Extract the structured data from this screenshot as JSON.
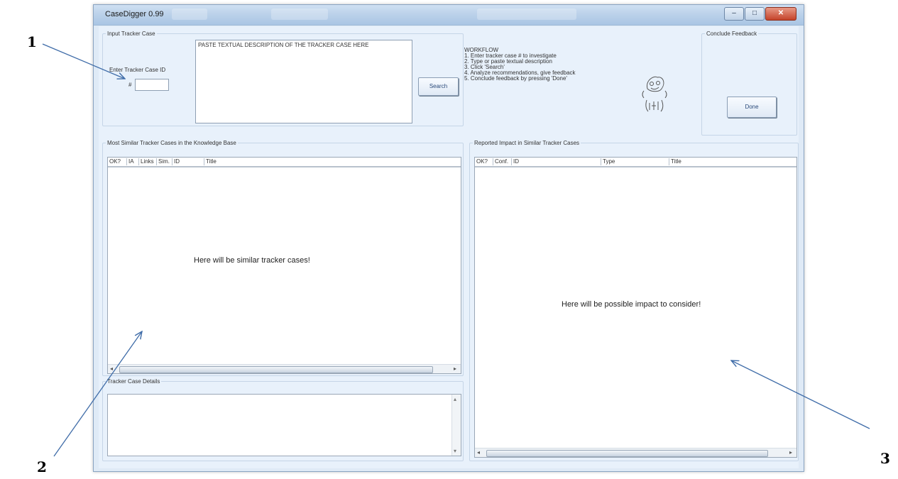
{
  "window": {
    "title": "CaseDigger 0.99",
    "buttons": {
      "minimize": "–",
      "maximize": "□",
      "close": "✕"
    }
  },
  "callouts": [
    "1",
    "2",
    "3"
  ],
  "input_group": {
    "legend": "Input Tracker Case",
    "case_id_label": "Enter Tracker Case ID",
    "hash_label": "#",
    "case_id_value": "",
    "description_placeholder": "PASTE TEXTUAL DESCRIPTION OF THE TRACKER CASE HERE",
    "search_button": "Search"
  },
  "workflow": {
    "heading": "WORKFLOW",
    "steps": [
      "1. Enter tracker case # to investigate",
      "2. Type or paste textual description",
      "3. Click 'Search'",
      "4. Analyze recommendations, give feedback",
      "5. Conclude feedback by pressing 'Done'"
    ],
    "mascot_icon": "digger-mascot-icon"
  },
  "feedback_group": {
    "legend": "Conclude Feedback",
    "done_button": "Done"
  },
  "similar_group": {
    "legend": "Most Similar Tracker Cases in the Knowledge Base",
    "columns": [
      "OK?",
      "IA",
      "Links",
      "Sim.",
      "ID",
      "Title"
    ],
    "placeholder": "Here will be similar tracker cases!"
  },
  "details_group": {
    "legend": "Tracker Case Details"
  },
  "impact_group": {
    "legend": "Reported Impact in Similar Tracker Cases",
    "columns": [
      "OK?",
      "Conf.",
      "ID",
      "Type",
      "Title"
    ],
    "placeholder": "Here will be possible impact to consider!"
  },
  "colors": {
    "window_bg": "#dfeaf6",
    "arrow": "#3f6ca8",
    "close_button": "#c4432a"
  }
}
